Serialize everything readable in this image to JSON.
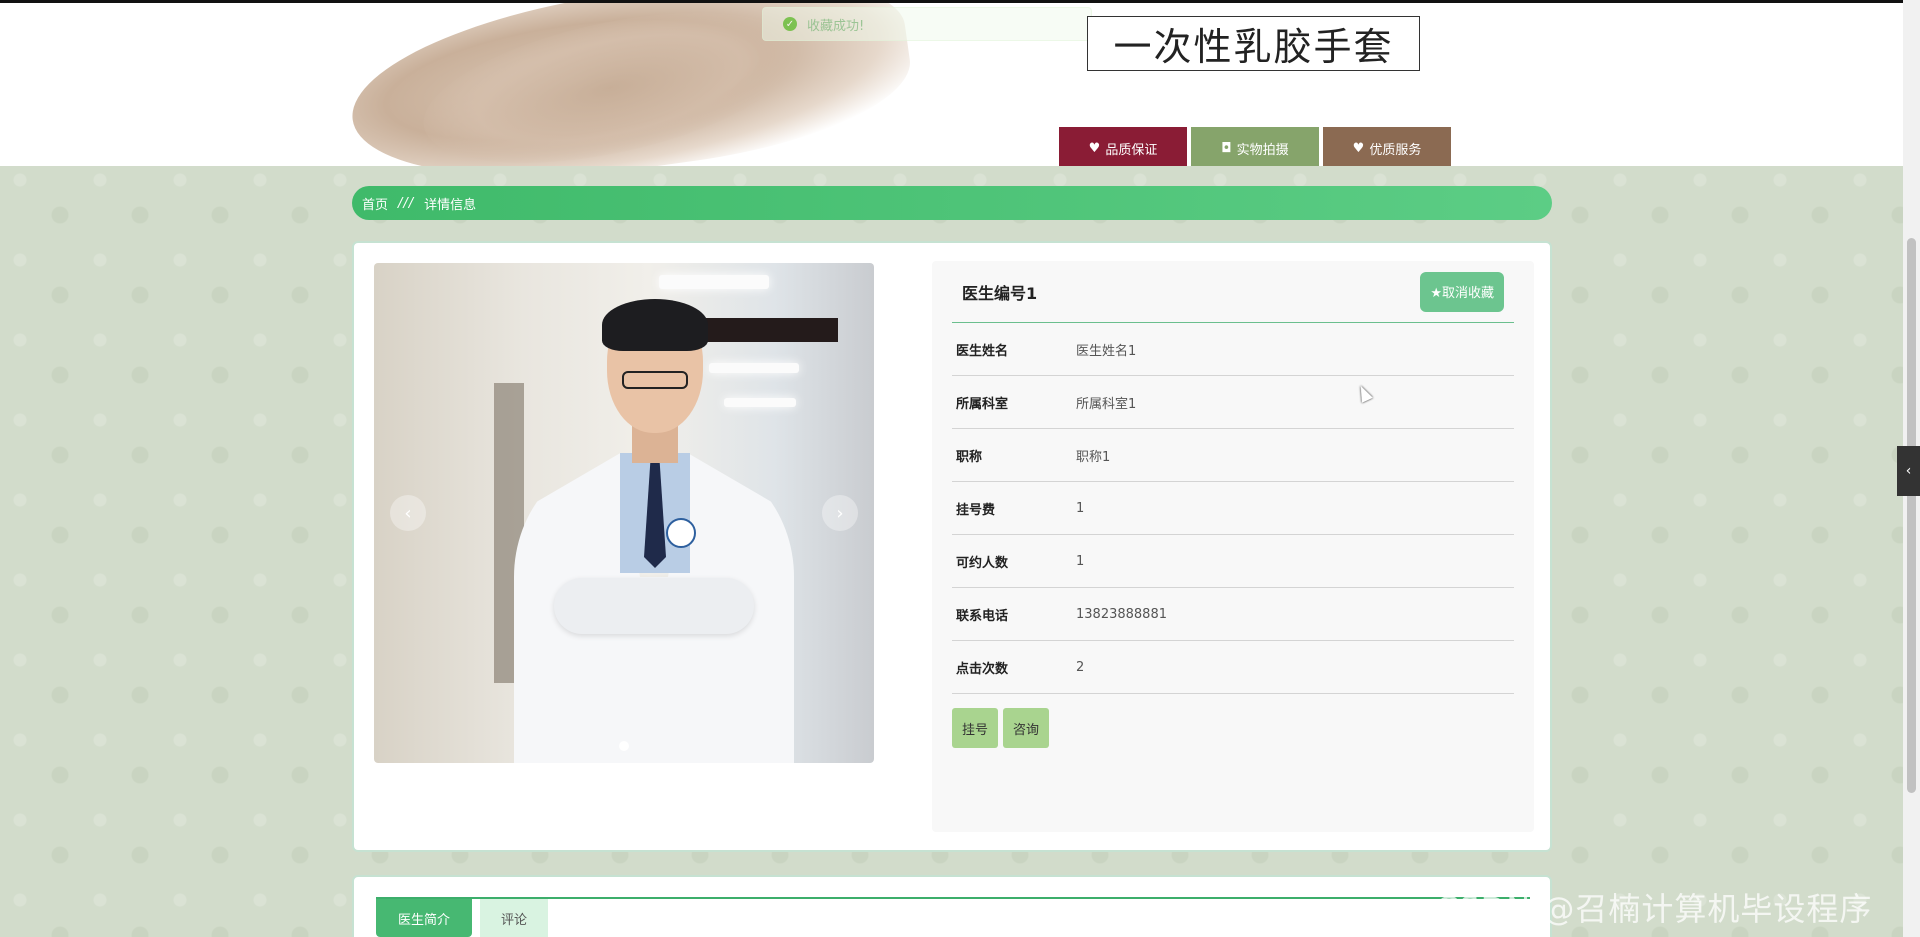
{
  "banner": {
    "product_title": "一次性乳胶手套",
    "toast": "收藏成功!",
    "badges": [
      {
        "label": "品质保证",
        "icon": "heart-icon",
        "color": "#8a1c35"
      },
      {
        "label": "实物拍摄",
        "icon": "camera-icon",
        "color": "#86a46b"
      },
      {
        "label": "优质服务",
        "icon": "heart-icon",
        "color": "#8b6a52"
      }
    ]
  },
  "breadcrumb": {
    "home": "首页",
    "separator": "///",
    "current": "详情信息"
  },
  "detail": {
    "title": "医生编号1",
    "unfavorite_label": "★取消收藏",
    "fields": [
      {
        "label": "医生姓名",
        "value": "医生姓名1"
      },
      {
        "label": "所属科室",
        "value": "所属科室1"
      },
      {
        "label": "职称",
        "value": "职称1"
      },
      {
        "label": "挂号费",
        "value": "1"
      },
      {
        "label": "可约人数",
        "value": "1"
      },
      {
        "label": "联系电话",
        "value": "13823888881"
      },
      {
        "label": "点击次数",
        "value": "2"
      }
    ],
    "actions": {
      "register": "挂号",
      "consult": "咨询"
    },
    "carousel": {
      "prev": "‹",
      "next": "›"
    }
  },
  "tabs": {
    "intro": "医生简介",
    "comment": "评论"
  },
  "side_toggle": "‹",
  "watermark": "CSDN @召楠计算机毕设程序",
  "colors": {
    "accent": "#47b872",
    "breadcrumb": "#3fba6a",
    "action_button": "#a9d48f"
  }
}
